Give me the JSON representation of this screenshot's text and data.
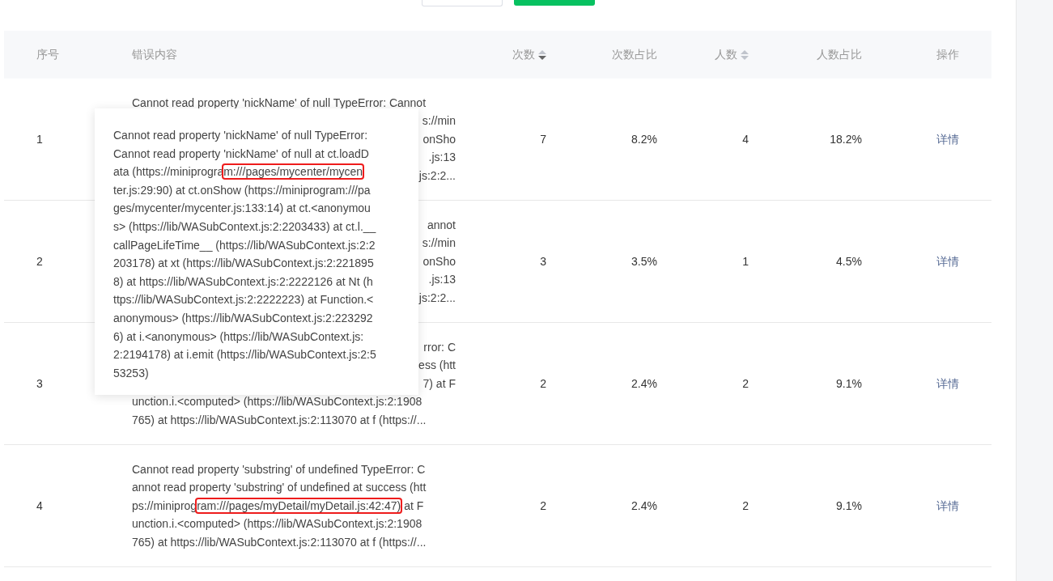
{
  "top_buttons": [
    {
      "kind": "outline"
    },
    {
      "kind": "primary"
    }
  ],
  "table": {
    "columns": [
      {
        "label": "序号"
      },
      {
        "label": "错误内容"
      },
      {
        "label": "次数",
        "sort_icon": {
          "descending": true
        }
      },
      {
        "label": "次数占比"
      },
      {
        "label": "人数",
        "sort_icon": {
          "descending": false
        }
      },
      {
        "label": "人数占比"
      },
      {
        "label": "操作"
      }
    ],
    "rows": [
      {
        "index": "1",
        "error_lines": [
          {
            "text": "Cannot read property 'nickName' of null TypeError: Cannot",
            "kind": "full"
          },
          {
            "text": "s://min",
            "kind": "tail"
          },
          {
            "text": "onSho",
            "kind": "tail"
          },
          {
            "text": ".js:13",
            "kind": "tail"
          },
          {
            "text": "js:2:2...",
            "kind": "tail"
          }
        ],
        "count": "7",
        "count_ratio": "8.2%",
        "users": "4",
        "users_ratio": "18.2%",
        "action": "详情"
      },
      {
        "index": "2",
        "error_lines": [
          {
            "text": "annot",
            "kind": "tail"
          },
          {
            "text": "s://min",
            "kind": "tail"
          },
          {
            "text": "onSho",
            "kind": "tail"
          },
          {
            "text": ".js:13",
            "kind": "tail"
          },
          {
            "text": "js:2:2...",
            "kind": "tail"
          }
        ],
        "count": "3",
        "count_ratio": "3.5%",
        "users": "1",
        "users_ratio": "4.5%",
        "action": "详情"
      },
      {
        "index": "3",
        "error_lines": [
          {
            "text": "rror: C",
            "kind": "tail"
          },
          {
            "text": "ess (htt",
            "kind": "tail"
          },
          {
            "text": "7) at F",
            "kind": "tail"
          },
          {
            "text": "unction.i.<computed> (https://lib/WASubContext.js:2:1908",
            "kind": "full"
          },
          {
            "text": "765) at https://lib/WASubContext.js:2:113070 at f (https://...",
            "kind": "full"
          }
        ],
        "count": "2",
        "count_ratio": "2.4%",
        "users": "2",
        "users_ratio": "9.1%",
        "action": "详情"
      },
      {
        "index": "4",
        "error_lines": [
          {
            "text": "Cannot read property 'substring' of undefined TypeError: C",
            "kind": "full"
          },
          {
            "text": "annot read property 'substring' of undefined at success (htt",
            "kind": "full"
          },
          {
            "segments": [
              {
                "text": "ps://miniprog",
                "boxed": false
              },
              {
                "text": "ram:///pages/myDetail/myDetail.js:42:47)",
                "boxed": true
              },
              {
                "text": " at F",
                "boxed": false
              }
            ],
            "kind": "segments"
          },
          {
            "text": "unction.i.<computed> (https://lib/WASubContext.js:2:1908",
            "kind": "full"
          },
          {
            "text": "765) at https://lib/WASubContext.js:2:113070 at f (https://...",
            "kind": "full"
          }
        ],
        "count": "2",
        "count_ratio": "2.4%",
        "users": "2",
        "users_ratio": "9.1%",
        "action": "详情"
      }
    ]
  },
  "tooltip": {
    "lines": [
      [
        {
          "text": "Cannot read property 'nickName' of null TypeError:",
          "boxed": false
        }
      ],
      [
        {
          "text": "Cannot read property 'nickName' of null at ct.loadD",
          "boxed": false
        }
      ],
      [
        {
          "text": "ata (https://miniprogra",
          "boxed": false
        },
        {
          "text": "m:///pages/mycenter/mycen",
          "boxed": true
        }
      ],
      [
        {
          "text": "ter.js:29:90) at ct.onShow (https://miniprogram:///pa",
          "boxed": false
        }
      ],
      [
        {
          "text": "ges/mycenter/mycenter.js:133:14) at ct.<anonymou",
          "boxed": false
        }
      ],
      [
        {
          "text": "s> (https://lib/WASubContext.js:2:2203433) at ct.l.__",
          "boxed": false
        }
      ],
      [
        {
          "text": "callPageLifeTime__ (https://lib/WASubContext.js:2:2",
          "boxed": false
        }
      ],
      [
        {
          "text": "203178) at xt (https://lib/WASubContext.js:2:221895",
          "boxed": false
        }
      ],
      [
        {
          "text": "8) at https://lib/WASubContext.js:2:2222126 at Nt (h",
          "boxed": false
        }
      ],
      [
        {
          "text": "ttps://lib/WASubContext.js:2:2222223) at Function.<",
          "boxed": false
        }
      ],
      [
        {
          "text": "anonymous> (https://lib/WASubContext.js:2:223292",
          "boxed": false
        }
      ],
      [
        {
          "text": "6) at i.<anonymous> (https://lib/WASubContext.js:",
          "boxed": false
        }
      ],
      [
        {
          "text": "2:2194178) at i.emit (https://lib/WASubContext.js:2:5",
          "boxed": false
        }
      ],
      [
        {
          "text": "53253)",
          "boxed": false
        }
      ]
    ]
  }
}
